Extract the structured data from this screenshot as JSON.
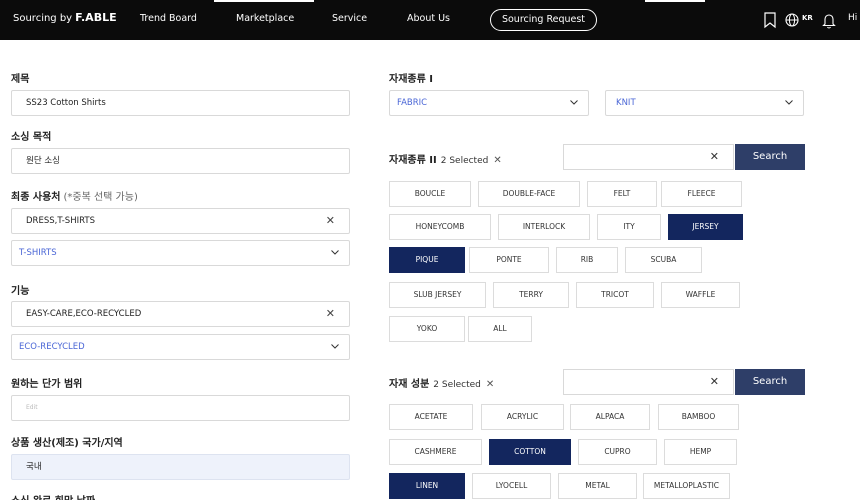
{
  "nav": {
    "brand_prefix": "Sourcing by",
    "brand_name": "F.ABLE",
    "items": [
      "Trend Board",
      "Marketplace",
      "Service",
      "About Us"
    ],
    "cta": "Sourcing Request",
    "lang": "KR",
    "greeting": "Hi",
    "icons": [
      "bookmark-icon",
      "globe-icon",
      "bell-icon"
    ]
  },
  "form": {
    "title_label": "제목",
    "title_value": "SS23 Cotton Shirts",
    "purpose_label": "소싱 목적",
    "purpose_value": "원단 소싱",
    "end_user_label": "최종 사용처",
    "end_user_note": "(*중복 선택 가능)",
    "end_user_value": "DRESS,T-SHIRTS",
    "end_user_select": "T-SHIRTS",
    "function_label": "기능",
    "function_value": "EASY-CARE,ECO-RECYCLED",
    "function_select": "ECO-RECYCLED",
    "price_label": "원하는 단가 범위",
    "price_placeholder": "Edit",
    "country_label": "상품 생산(제조) 국가/지역",
    "country_value": "국내",
    "deadline_label": "소싱 완료 희망 날짜"
  },
  "material": {
    "type1_label": "자재종류 I",
    "type1_select_a": "FABRIC",
    "type1_select_b": "KNIT",
    "type2_label": "자재종류 II",
    "type2_selected": "2 Selected",
    "type2_chips": [
      "BOUCLE",
      "DOUBLE-FACE",
      "FELT",
      "FLEECE",
      "HONEYCOMB",
      "INTERLOCK",
      "ITY",
      "JERSEY",
      "PIQUE",
      "PONTE",
      "RIB",
      "SCUBA",
      "SLUB JERSEY",
      "TERRY",
      "TRICOT",
      "WAFFLE",
      "YOKO",
      "ALL"
    ],
    "type2_active": [
      "JERSEY",
      "PIQUE"
    ],
    "comp_label": "자재 성분",
    "comp_selected": "2 Selected",
    "comp_chips": [
      "ACETATE",
      "ACRYLIC",
      "ALPACA",
      "BAMBOO",
      "CASHMERE",
      "COTTON",
      "CUPRO",
      "HEMP",
      "LINEN",
      "LYOCELL",
      "METAL",
      "METALLOPLASTIC"
    ],
    "comp_active": [
      "COTTON",
      "LINEN"
    ],
    "search_label": "Search"
  },
  "colors": {
    "accent_blue": "#4a66d6",
    "chip_active": "#13265e",
    "search_button": "#2e3e68",
    "nav_bg": "#0b0b0b"
  }
}
